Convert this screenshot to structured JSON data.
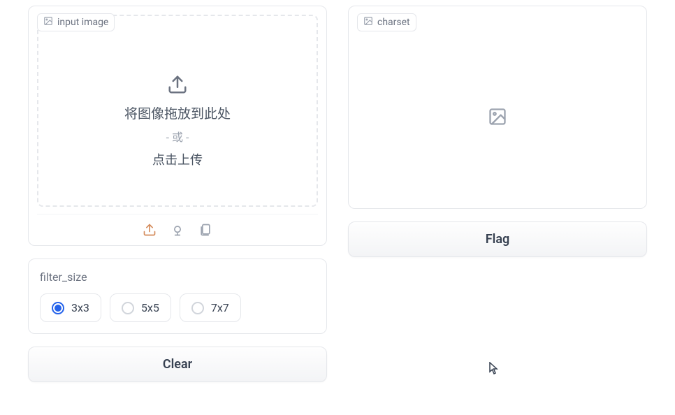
{
  "input_panel": {
    "label": "input image",
    "dropzone": {
      "drag_text": "将图像拖放到此处",
      "or_text": "- 或 -",
      "click_text": "点击上传"
    },
    "tool_icons": {
      "upload": "upload-icon",
      "camera": "camera-icon",
      "paste": "paste-icon"
    }
  },
  "filter": {
    "title": "filter_size",
    "options": [
      {
        "label": "3x3",
        "selected": true
      },
      {
        "label": "5x5",
        "selected": false
      },
      {
        "label": "7x7",
        "selected": false
      }
    ]
  },
  "buttons": {
    "clear": "Clear",
    "flag": "Flag"
  },
  "output_panel": {
    "label": "charset"
  }
}
